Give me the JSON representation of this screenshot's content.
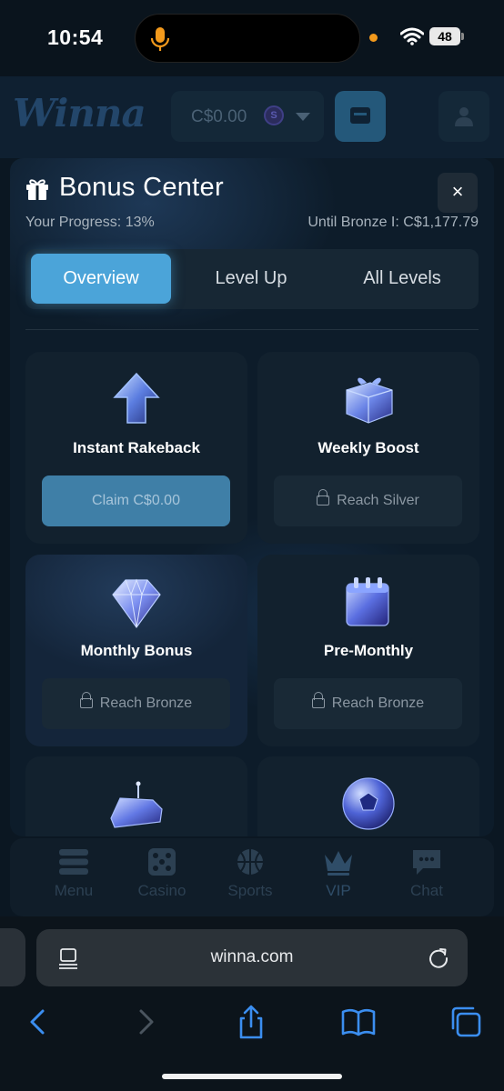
{
  "status_bar": {
    "time": "10:54",
    "battery": "48"
  },
  "site_header": {
    "logo": "Winna",
    "balance": "C$0.00",
    "coin_label": "S"
  },
  "modal": {
    "title": "Bonus Center",
    "close_label": "×",
    "progress_left": "Your Progress: 13%",
    "progress_right": "Until Bronze I: C$1,177.79",
    "tabs": [
      {
        "label": "Overview",
        "active": true
      },
      {
        "label": "Level Up",
        "active": false
      },
      {
        "label": "All Levels",
        "active": false
      }
    ],
    "cards": [
      {
        "title": "Instant Rakeback",
        "icon": "arrow-up-icon",
        "button": "Claim C$0.00",
        "locked": false
      },
      {
        "title": "Weekly Boost",
        "icon": "gift-box-icon",
        "button": "Reach Silver",
        "locked": true
      },
      {
        "title": "Monthly Bonus",
        "icon": "diamond-icon",
        "button": "Reach Bronze",
        "locked": true
      },
      {
        "title": "Pre-Monthly",
        "icon": "calendar-icon",
        "button": "Reach Bronze",
        "locked": true
      },
      {
        "title": "",
        "icon": "cake-icon",
        "button": "",
        "locked": true
      },
      {
        "title": "",
        "icon": "soccer-ball-icon",
        "button": "",
        "locked": true
      }
    ]
  },
  "site_nav": [
    {
      "label": "Menu",
      "icon": "menu-icon"
    },
    {
      "label": "Casino",
      "icon": "dice-icon"
    },
    {
      "label": "Sports",
      "icon": "basketball-icon"
    },
    {
      "label": "VIP",
      "icon": "crown-icon"
    },
    {
      "label": "Chat",
      "icon": "chat-icon"
    }
  ],
  "browser": {
    "url": "winna.com"
  },
  "colors": {
    "accent": "#4ba4d9",
    "background": "#0b1722",
    "card": "#12212e",
    "claim_button": "#3f7fa7"
  }
}
